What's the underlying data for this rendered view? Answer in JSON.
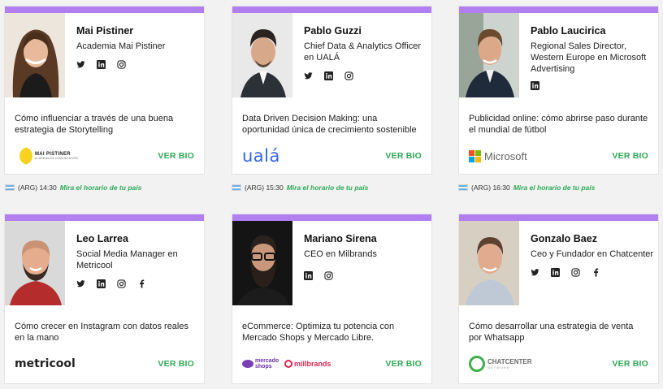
{
  "speakers": [
    {
      "name": "Mai Pistiner",
      "role": "Academia Mai Pistiner",
      "talk": "Cómo influenciar a través de una buena estrategia de Storytelling",
      "logo_text": "MAI PISTINER",
      "logo_sub": "ACADEMIA DE COMUNICACIÓN",
      "socials": [
        "twitter-icon",
        "linkedin-icon",
        "instagram-icon"
      ],
      "cta": "VER BIO",
      "time": "(ARG) 14:30",
      "schedule_link": "Mira el horario de tu país"
    },
    {
      "name": "Pablo Guzzi",
      "role": "Chief Data & Analytics Officer en UALÁ",
      "talk": "Data Driven Decision Making: una oportunidad única de crecimiento sostenible",
      "logo_text": "ualá",
      "socials": [
        "twitter-icon",
        "linkedin-icon",
        "instagram-icon"
      ],
      "cta": "VER BIO",
      "time": "(ARG) 15:30",
      "schedule_link": "Mira el horario de tu país"
    },
    {
      "name": "Pablo Laucirica",
      "role": "Regional Sales Director, Western Europe en Microsoft Advertising",
      "talk": "Publicidad online: cómo abrirse paso durante el mundial de fútbol",
      "logo_text": "Microsoft",
      "socials": [
        "linkedin-icon"
      ],
      "cta": "VER BIO",
      "time": "(ARG) 16:30",
      "schedule_link": "Mira el horario de tu país"
    },
    {
      "name": "Leo Larrea",
      "role": "Social Media Manager en Metricool",
      "talk": "Cómo crecer en Instagram con datos reales en la mano",
      "logo_text": "metricool",
      "socials": [
        "twitter-icon",
        "linkedin-icon",
        "instagram-icon",
        "facebook-icon"
      ],
      "cta": "VER BIO"
    },
    {
      "name": "Mariano Sirena",
      "role": "CEO en Milbrands",
      "talk": "eCommerce: Optimiza tu potencia con Mercado Shops y Mercado Libre.",
      "logo_text": "mercado shops",
      "logo_text2": "millbrands",
      "socials": [
        "linkedin-icon",
        "instagram-icon"
      ],
      "cta": "VER BIO"
    },
    {
      "name": "Gonzalo Baez",
      "role": "Ceo y Fundador en Chatcenter",
      "talk": "Cómo desarrollar una estrategia de venta por Whatsapp",
      "logo_text": "CHATCENTER",
      "logo_sub": "NETWORK",
      "socials": [
        "twitter-icon",
        "linkedin-icon",
        "instagram-icon",
        "facebook-icon"
      ],
      "cta": "VER BIO"
    }
  ],
  "colors": {
    "accent_bar": "#b27ff0",
    "cta": "#2eaa56"
  }
}
